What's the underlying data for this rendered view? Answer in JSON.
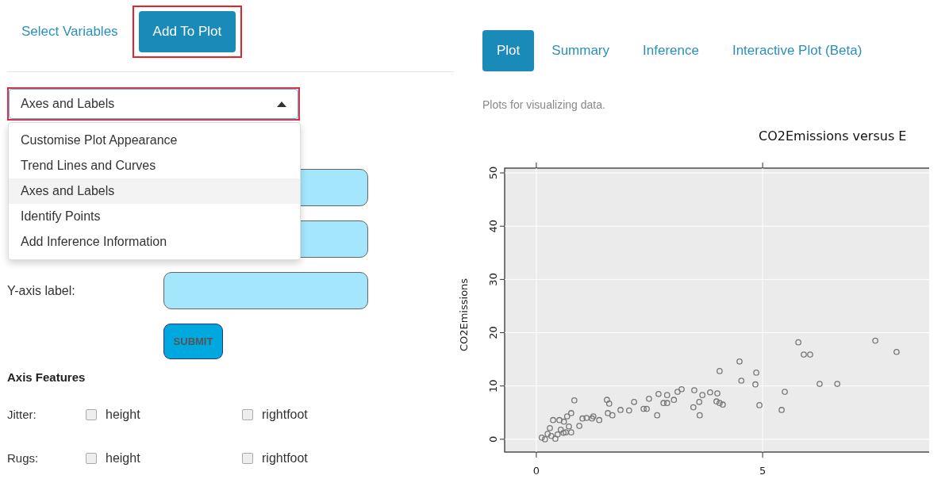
{
  "left_tabs": [
    {
      "label": "Select Variables",
      "selected": false,
      "highlighted": false
    },
    {
      "label": "Add To Plot",
      "selected": true,
      "highlighted": true
    }
  ],
  "options_select": {
    "value": "Axes and Labels",
    "expanded": true,
    "highlighted": true,
    "options": [
      {
        "label": "Customise Plot Appearance",
        "selected": false
      },
      {
        "label": "Trend Lines and Curves",
        "selected": false
      },
      {
        "label": "Axes and Labels",
        "selected": true
      },
      {
        "label": "Identify Points",
        "selected": false
      },
      {
        "label": "Add Inference Information",
        "selected": false
      }
    ]
  },
  "label_fields": [
    {
      "kind": "text"
    },
    {
      "kind": "text"
    },
    {
      "kind": "text",
      "label": "Y-axis label:"
    }
  ],
  "submit_button": "SUBMIT",
  "axis_features": {
    "title": "Axis Features",
    "rows": [
      {
        "label": "Jitter:",
        "options": [
          {
            "label": "height",
            "checked": false
          },
          {
            "label": "rightfoot",
            "checked": false
          }
        ]
      },
      {
        "label": "Rugs:",
        "options": [
          {
            "label": "height",
            "checked": false
          },
          {
            "label": "rightfoot",
            "checked": false
          }
        ]
      }
    ]
  },
  "plot_tabs": [
    {
      "label": "Plot",
      "selected": true
    },
    {
      "label": "Summary",
      "selected": false
    },
    {
      "label": "Inference",
      "selected": false
    },
    {
      "label": "Interactive Plot (Beta)",
      "selected": false
    }
  ],
  "plot_panel": {
    "caption": "Plots for visualizing data.",
    "chart_data": {
      "type": "scatter",
      "title": "CO2Emissions versus E",
      "ylabel": "CO2Emissions",
      "x": [
        7.49,
        7.96,
        5.79,
        5.91,
        6.05,
        4.49,
        4.53,
        4.86,
        4.84,
        4.05,
        6.26,
        6.65,
        5.49,
        5.42,
        4.93,
        4.12,
        3.67,
        3.84,
        4.0,
        3.98,
        4.05,
        3.49,
        3.47,
        3.6,
        3.61,
        3.12,
        3.21,
        2.89,
        2.89,
        3.04,
        2.49,
        2.7,
        2.81,
        2.44,
        2.67,
        2.16,
        2.37,
        1.86,
        2.05,
        1.61,
        1.68,
        1.39,
        1.23,
        1.26,
        1.58,
        1.11,
        0.95,
        0.84,
        1.56,
        0.77,
        1.02,
        0.61,
        0.51,
        0.37,
        0.3,
        0.68,
        0.72,
        0.12,
        0.25,
        0.33,
        0.47,
        0.6,
        0.19,
        0.42,
        0.65,
        0.54,
        0.77
      ],
      "grid": true,
      "series": [
        {
          "color": "#777777",
          "values": [
            18.5,
            16.4,
            18.2,
            15.9,
            15.9,
            14.6,
            11.0,
            12.5,
            10.3,
            12.8,
            10.4,
            10.4,
            8.9,
            5.5,
            6.4,
            6.5,
            8.3,
            8.8,
            8.6,
            7.1,
            6.8,
            9.2,
            6.0,
            7.0,
            4.5,
            8.9,
            9.4,
            8.3,
            6.8,
            7.4,
            7.6,
            8.5,
            6.8,
            5.7,
            4.5,
            7.0,
            5.7,
            5.5,
            5.4,
            6.7,
            4.5,
            3.6,
            3.9,
            4.3,
            4.9,
            4.0,
            2.5,
            7.3,
            7.4,
            4.9,
            3.9,
            3.3,
            3.6,
            3.6,
            2.1,
            4.3,
            2.4,
            0.3,
            1.0,
            0.6,
            0.9,
            1.2,
            0.0,
            0.1,
            1.3,
            1.8,
            1.3
          ]
        }
      ],
      "xlim": [
        -0.7,
        8.68
      ],
      "ylim": [
        -2.4,
        50.9
      ],
      "xticks": [
        0,
        5
      ],
      "yticks": [
        0,
        10,
        20,
        30,
        40,
        50
      ]
    }
  }
}
